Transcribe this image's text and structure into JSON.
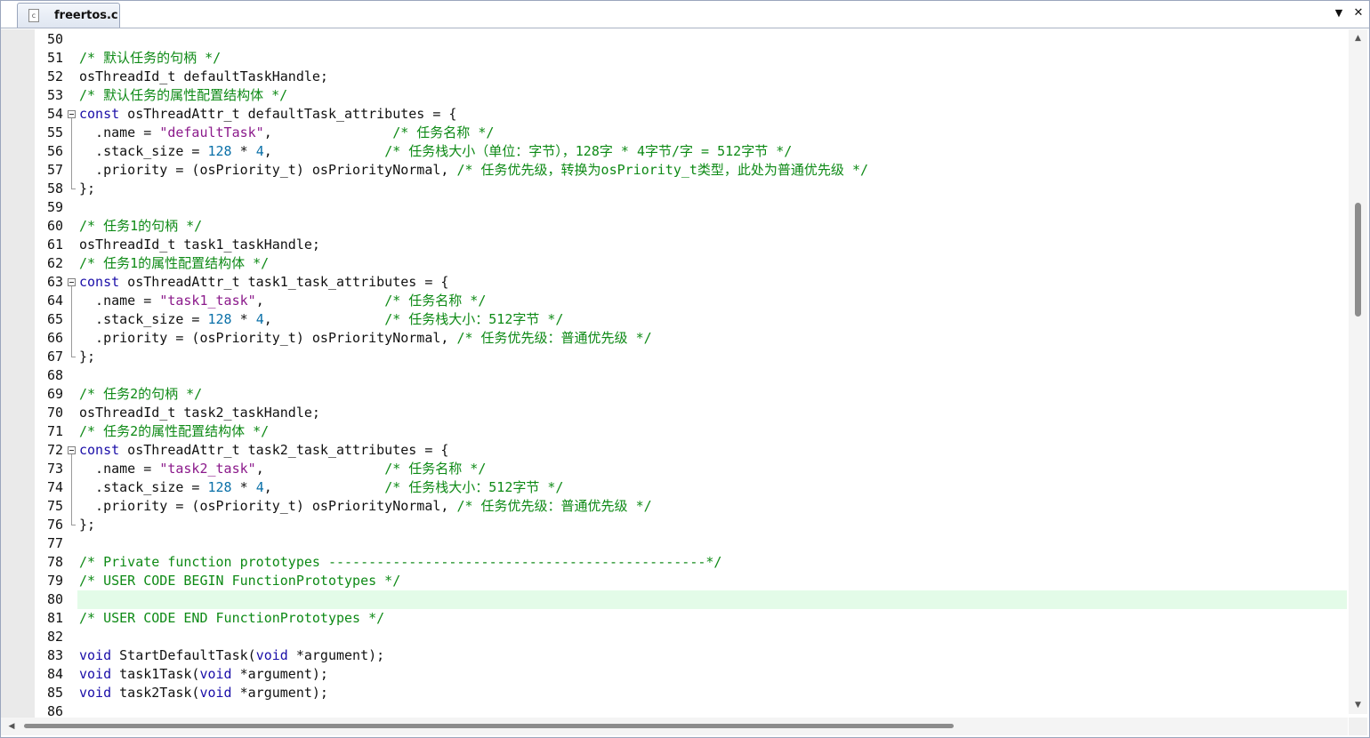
{
  "tab": {
    "filename": "freertos.c",
    "file_icon": "c-source-file-icon"
  },
  "toolbar": {
    "dropdown_icon": "▼",
    "close_icon": "✕"
  },
  "scrollbars": {
    "up_icon": "▲",
    "down_icon": "▼",
    "left_icon": "◀"
  },
  "editor": {
    "highlighted_line": 80,
    "fold_markers": [
      {
        "start": 54,
        "end": 58
      },
      {
        "start": 63,
        "end": 67
      },
      {
        "start": 72,
        "end": 76
      }
    ],
    "lines": [
      {
        "n": "50",
        "tokens": []
      },
      {
        "n": "51",
        "tokens": [
          [
            "cm",
            "/* 默认任务的句柄 */"
          ]
        ]
      },
      {
        "n": "52",
        "tokens": [
          [
            "pl",
            "osThreadId_t defaultTaskHandle;"
          ]
        ]
      },
      {
        "n": "53",
        "tokens": [
          [
            "cm",
            "/* 默认任务的属性配置结构体 */"
          ]
        ]
      },
      {
        "n": "54",
        "tokens": [
          [
            "kw",
            "const"
          ],
          [
            "pl",
            " osThreadAttr_t defaultTask_attributes = {"
          ]
        ]
      },
      {
        "n": "55",
        "tokens": [
          [
            "pl",
            "  .name = "
          ],
          [
            "str",
            "\"defaultTask\""
          ],
          [
            "pl",
            ",               "
          ],
          [
            "cm",
            "/* 任务名称 */"
          ]
        ]
      },
      {
        "n": "56",
        "tokens": [
          [
            "pl",
            "  .stack_size = "
          ],
          [
            "num",
            "128"
          ],
          [
            "pl",
            " * "
          ],
          [
            "num",
            "4"
          ],
          [
            "pl",
            ",              "
          ],
          [
            "cm",
            "/* 任务栈大小（单位：字节），128字 * 4字节/字 = 512字节 */"
          ]
        ]
      },
      {
        "n": "57",
        "tokens": [
          [
            "pl",
            "  .priority = (osPriority_t) osPriorityNormal, "
          ],
          [
            "cm",
            "/* 任务优先级，转换为osPriority_t类型，此处为普通优先级 */"
          ]
        ]
      },
      {
        "n": "58",
        "tokens": [
          [
            "pl",
            "};"
          ]
        ]
      },
      {
        "n": "59",
        "tokens": []
      },
      {
        "n": "60",
        "tokens": [
          [
            "cm",
            "/* 任务1的句柄 */"
          ]
        ]
      },
      {
        "n": "61",
        "tokens": [
          [
            "pl",
            "osThreadId_t task1_taskHandle;"
          ]
        ]
      },
      {
        "n": "62",
        "tokens": [
          [
            "cm",
            "/* 任务1的属性配置结构体 */"
          ]
        ]
      },
      {
        "n": "63",
        "tokens": [
          [
            "kw",
            "const"
          ],
          [
            "pl",
            " osThreadAttr_t task1_task_attributes = {"
          ]
        ]
      },
      {
        "n": "64",
        "tokens": [
          [
            "pl",
            "  .name = "
          ],
          [
            "str",
            "\"task1_task\""
          ],
          [
            "pl",
            ",               "
          ],
          [
            "cm",
            "/* 任务名称 */"
          ]
        ]
      },
      {
        "n": "65",
        "tokens": [
          [
            "pl",
            "  .stack_size = "
          ],
          [
            "num",
            "128"
          ],
          [
            "pl",
            " * "
          ],
          [
            "num",
            "4"
          ],
          [
            "pl",
            ",              "
          ],
          [
            "cm",
            "/* 任务栈大小：512字节 */"
          ]
        ]
      },
      {
        "n": "66",
        "tokens": [
          [
            "pl",
            "  .priority = (osPriority_t) osPriorityNormal, "
          ],
          [
            "cm",
            "/* 任务优先级：普通优先级 */"
          ]
        ]
      },
      {
        "n": "67",
        "tokens": [
          [
            "pl",
            "};"
          ]
        ]
      },
      {
        "n": "68",
        "tokens": []
      },
      {
        "n": "69",
        "tokens": [
          [
            "cm",
            "/* 任务2的句柄 */"
          ]
        ]
      },
      {
        "n": "70",
        "tokens": [
          [
            "pl",
            "osThreadId_t task2_taskHandle;"
          ]
        ]
      },
      {
        "n": "71",
        "tokens": [
          [
            "cm",
            "/* 任务2的属性配置结构体 */"
          ]
        ]
      },
      {
        "n": "72",
        "tokens": [
          [
            "kw",
            "const"
          ],
          [
            "pl",
            " osThreadAttr_t task2_task_attributes = {"
          ]
        ]
      },
      {
        "n": "73",
        "tokens": [
          [
            "pl",
            "  .name = "
          ],
          [
            "str",
            "\"task2_task\""
          ],
          [
            "pl",
            ",               "
          ],
          [
            "cm",
            "/* 任务名称 */"
          ]
        ]
      },
      {
        "n": "74",
        "tokens": [
          [
            "pl",
            "  .stack_size = "
          ],
          [
            "num",
            "128"
          ],
          [
            "pl",
            " * "
          ],
          [
            "num",
            "4"
          ],
          [
            "pl",
            ",              "
          ],
          [
            "cm",
            "/* 任务栈大小：512字节 */"
          ]
        ]
      },
      {
        "n": "75",
        "tokens": [
          [
            "pl",
            "  .priority = (osPriority_t) osPriorityNormal, "
          ],
          [
            "cm",
            "/* 任务优先级：普通优先级 */"
          ]
        ]
      },
      {
        "n": "76",
        "tokens": [
          [
            "pl",
            "};"
          ]
        ]
      },
      {
        "n": "77",
        "tokens": []
      },
      {
        "n": "78",
        "tokens": [
          [
            "cm",
            "/* Private function prototypes -----------------------------------------------*/"
          ]
        ]
      },
      {
        "n": "79",
        "tokens": [
          [
            "cm",
            "/* USER CODE BEGIN FunctionPrototypes */"
          ]
        ]
      },
      {
        "n": "80",
        "tokens": []
      },
      {
        "n": "81",
        "tokens": [
          [
            "cm",
            "/* USER CODE END FunctionPrototypes */"
          ]
        ]
      },
      {
        "n": "82",
        "tokens": []
      },
      {
        "n": "83",
        "tokens": [
          [
            "kw",
            "void"
          ],
          [
            "pl",
            " StartDefaultTask("
          ],
          [
            "kw",
            "void"
          ],
          [
            "pl",
            " *argument);"
          ]
        ]
      },
      {
        "n": "84",
        "tokens": [
          [
            "kw",
            "void"
          ],
          [
            "pl",
            " task1Task("
          ],
          [
            "kw",
            "void"
          ],
          [
            "pl",
            " *argument);"
          ]
        ]
      },
      {
        "n": "85",
        "tokens": [
          [
            "kw",
            "void"
          ],
          [
            "pl",
            " task2Task("
          ],
          [
            "kw",
            "void"
          ],
          [
            "pl",
            " *argument);"
          ]
        ]
      },
      {
        "n": "86",
        "tokens": []
      }
    ]
  }
}
